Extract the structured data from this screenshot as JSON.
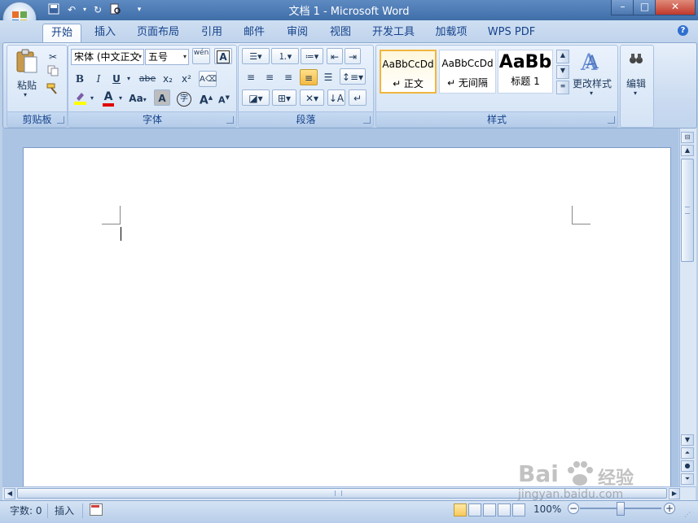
{
  "window": {
    "title": "文档 1 - Microsoft Word"
  },
  "tabs": [
    "开始",
    "插入",
    "页面布局",
    "引用",
    "邮件",
    "审阅",
    "视图",
    "开发工具",
    "加载项",
    "WPS PDF"
  ],
  "clipboard": {
    "paste_label": "粘贴",
    "group_label": "剪贴板"
  },
  "font": {
    "name": "宋体 (中文正文",
    "size": "五号",
    "group_label": "字体",
    "bold": "B",
    "italic": "I",
    "underline": "U",
    "strike": "abe",
    "subscript": "x₂",
    "superscript": "x²",
    "grow": "A",
    "shrink": "A",
    "change_case": "Aa",
    "phonetic": "wén",
    "border_char": "A",
    "shade_char": "A",
    "enclose": "字",
    "highlight_color": "#ffff00",
    "font_color": "#e00000"
  },
  "paragraph": {
    "group_label": "段落"
  },
  "styles": {
    "group_label": "样式",
    "items": [
      {
        "sample": "AaBbCcDd",
        "name": "↵ 正文"
      },
      {
        "sample": "AaBbCcDd",
        "name": "↵ 无间隔"
      },
      {
        "sample": "AaBb",
        "name": "标题 1"
      }
    ],
    "change_styles_label": "更改样式",
    "editing_label": "编辑"
  },
  "statusbar": {
    "word_count": "字数: 0",
    "mode": "插入",
    "zoom": "100%"
  },
  "watermark": {
    "brand": "Bai",
    "brand_suffix": "经验",
    "url": "jingyan.baidu.com"
  },
  "colors": {
    "ribbon_accent": "#15428b",
    "selected_style": "#f0b640"
  }
}
